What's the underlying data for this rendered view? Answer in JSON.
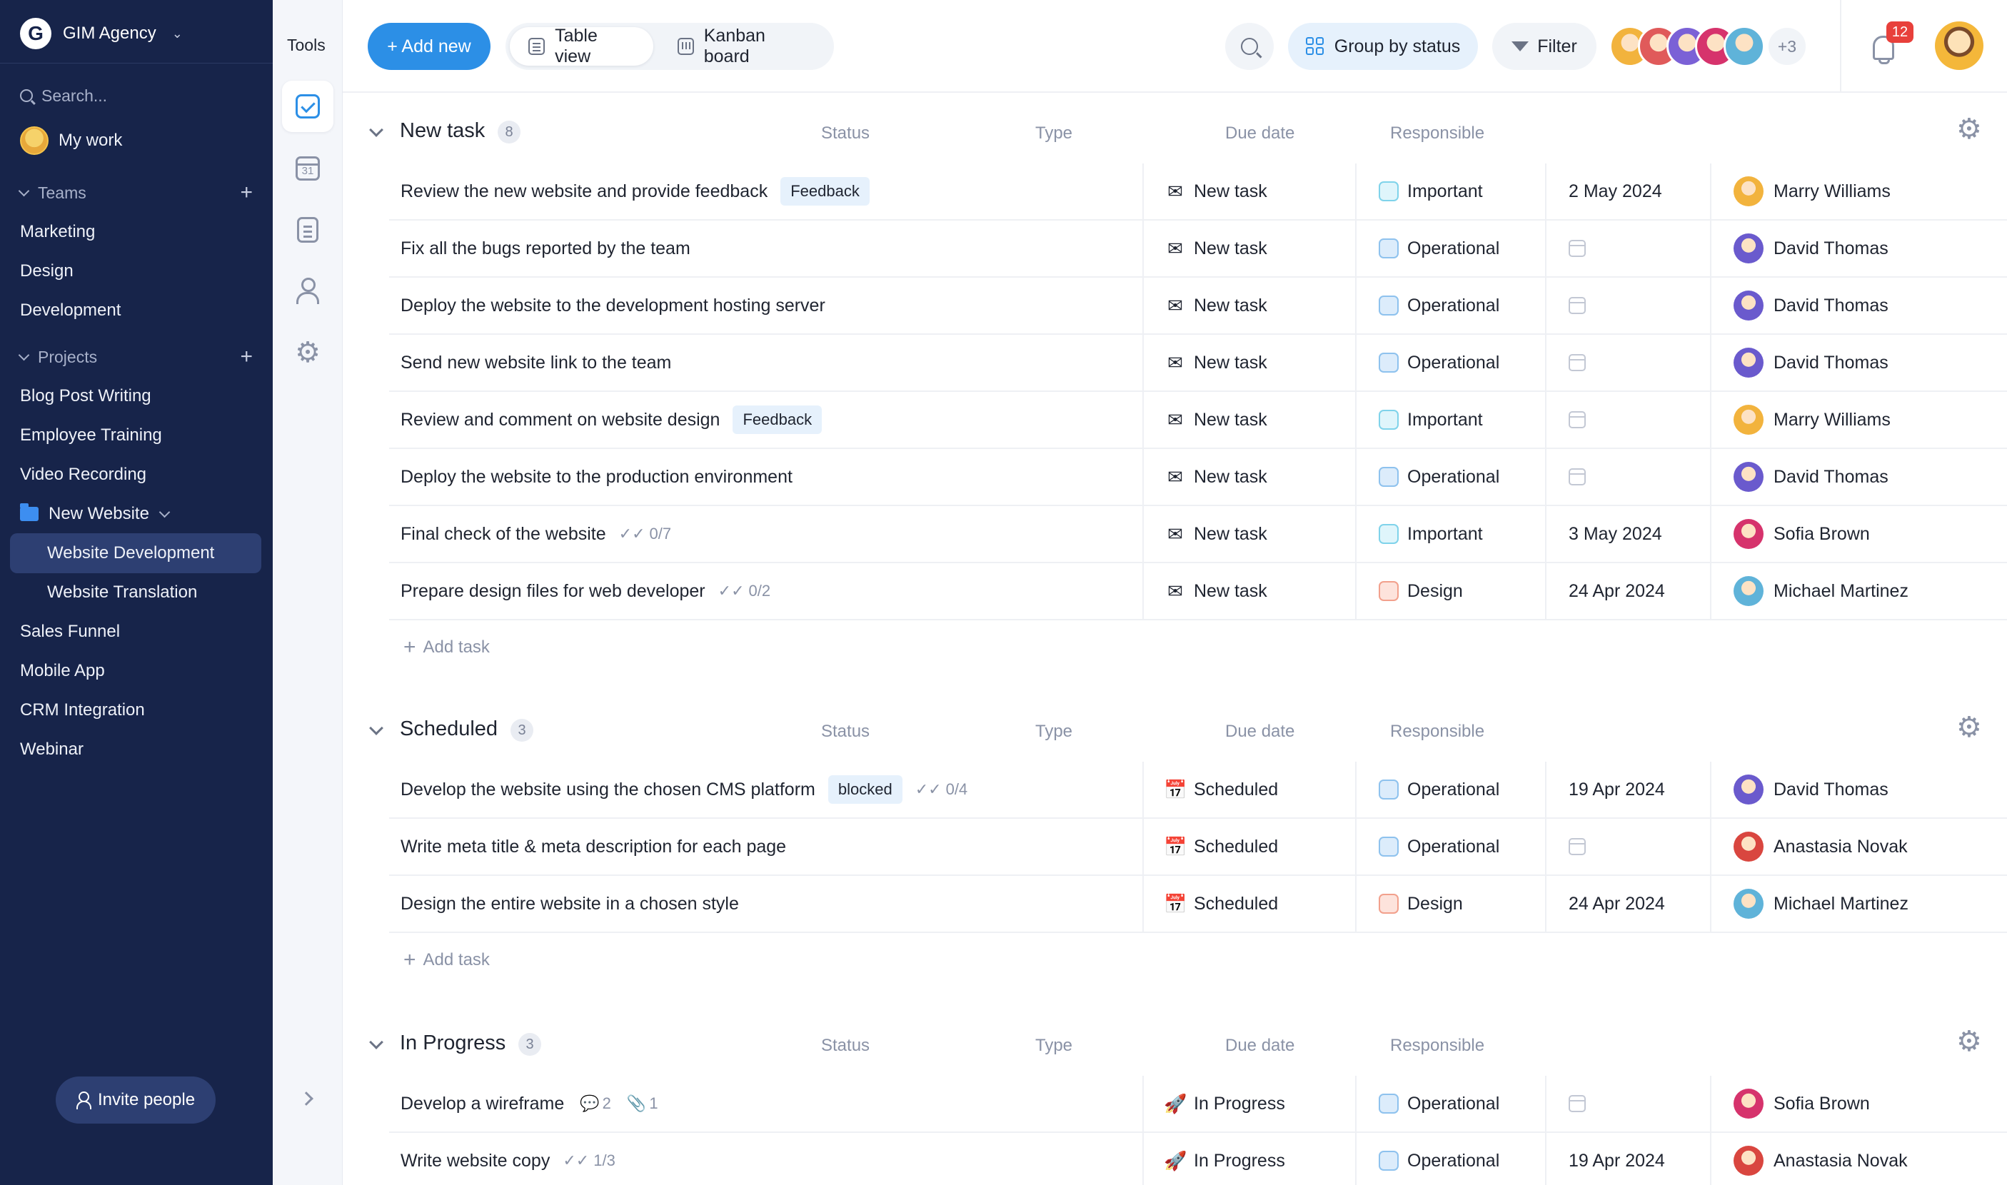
{
  "sidebar": {
    "brand": "GIM Agency",
    "brand_logo": "G",
    "search_placeholder": "Search...",
    "my_work": "My work",
    "teams_label": "Teams",
    "teams": [
      "Marketing",
      "Design",
      "Development"
    ],
    "projects_label": "Projects",
    "projects_top": [
      "Blog Post Writing",
      "Employee Training",
      "Video Recording"
    ],
    "folder": "New Website",
    "folder_items": [
      "Website Development",
      "Website Translation"
    ],
    "projects_bottom": [
      "Sales Funnel",
      "Mobile App",
      "CRM Integration",
      "Webinar"
    ],
    "invite": "Invite people"
  },
  "tools": {
    "title": "Tools"
  },
  "topbar": {
    "add_new": "+ Add new",
    "table_view": "Table view",
    "kanban_board": "Kanban board",
    "group_by": "Group by status",
    "filter": "Filter",
    "more_people": "+3",
    "notifications": "12"
  },
  "columns": {
    "status": "Status",
    "type": "Type",
    "due": "Due date",
    "responsible": "Responsible"
  },
  "add_task": "Add task",
  "groups": [
    {
      "title": "New task",
      "count": "8",
      "rows": [
        {
          "name": "Review the new website and provide feedback",
          "tag": "Feedback",
          "status": "New task",
          "type": "Important",
          "due": "2 May 2024",
          "person": "Marry Williams"
        },
        {
          "name": "Fix all the bugs reported by the team",
          "status": "New task",
          "type": "Operational",
          "due": "",
          "person": "David Thomas"
        },
        {
          "name": "Deploy the website to the development hosting server",
          "status": "New task",
          "type": "Operational",
          "due": "",
          "person": "David Thomas"
        },
        {
          "name": "Send new website link to the team",
          "status": "New task",
          "type": "Operational",
          "due": "",
          "person": "David Thomas"
        },
        {
          "name": "Review and comment on website design",
          "tag": "Feedback",
          "status": "New task",
          "type": "Important",
          "due": "",
          "person": "Marry Williams"
        },
        {
          "name": "Deploy the website to the production environment",
          "status": "New task",
          "type": "Operational",
          "due": "",
          "person": "David Thomas"
        },
        {
          "name": "Final check of the website",
          "subtasks": "0/7",
          "status": "New task",
          "type": "Important",
          "due": "3 May 2024",
          "person": "Sofia Brown"
        },
        {
          "name": "Prepare design files for web developer",
          "subtasks": "0/2",
          "status": "New task",
          "type": "Design",
          "due": "24 Apr 2024",
          "person": "Michael Martinez"
        }
      ]
    },
    {
      "title": "Scheduled",
      "count": "3",
      "rows": [
        {
          "name": "Develop the website using the chosen CMS platform",
          "tag": "blocked",
          "subtasks": "0/4",
          "status": "Scheduled",
          "type": "Operational",
          "due": "19 Apr 2024",
          "person": "David Thomas"
        },
        {
          "name": "Write meta title & meta description for each page",
          "status": "Scheduled",
          "type": "Operational",
          "due": "",
          "person": "Anastasia Novak"
        },
        {
          "name": "Design the entire website in a chosen style",
          "status": "Scheduled",
          "type": "Design",
          "due": "24 Apr 2024",
          "person": "Michael Martinez"
        }
      ]
    },
    {
      "title": "In Progress",
      "count": "3",
      "rows": [
        {
          "name": "Develop a wireframe",
          "comments": "2",
          "attachments": "1",
          "status": "In Progress",
          "type": "Operational",
          "due": "",
          "person": "Sofia Brown"
        },
        {
          "name": "Write website copy",
          "subtasks": "1/3",
          "status": "In Progress",
          "type": "Operational",
          "due": "19 Apr 2024",
          "person": "Anastasia Novak"
        }
      ]
    }
  ],
  "status_icons": {
    "New task": "✉",
    "Scheduled": "📅",
    "In Progress": "🚀"
  },
  "type_colors": {
    "Important": {
      "fill": "#dff5fb",
      "border": "#7fd3ea"
    },
    "Operational": {
      "fill": "#dcecfb",
      "border": "#8ec2ee"
    },
    "Design": {
      "fill": "#fde3dc",
      "border": "#f2a08c"
    }
  },
  "person_colors": {
    "Marry Williams": "#f2b33d",
    "David Thomas": "#6a5acd",
    "Sofia Brown": "#d6336c",
    "Michael Martinez": "#5fb3d9",
    "Anastasia Novak": "#d9463f"
  },
  "top_avatar_colors": [
    "#f2b33d",
    "#e05a5a",
    "#7b61d6",
    "#d6336c",
    "#5fb3d9"
  ],
  "accent": "#2c8fe6"
}
